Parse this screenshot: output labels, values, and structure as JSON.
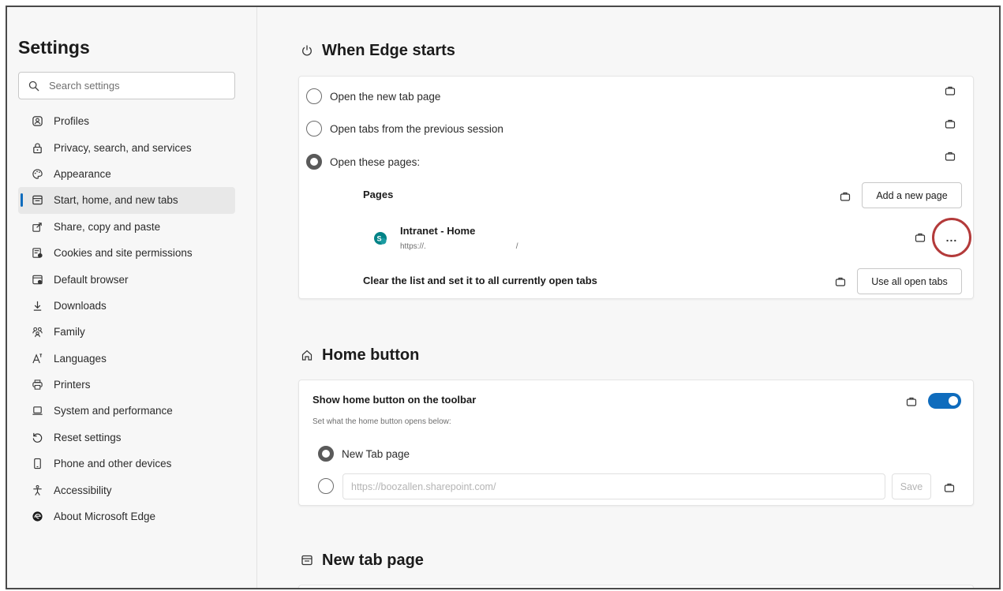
{
  "sidebar": {
    "title": "Settings",
    "search_placeholder": "Search settings",
    "items": [
      {
        "label": "Profiles",
        "icon": "profile-icon"
      },
      {
        "label": "Privacy, search, and services",
        "icon": "lock-icon"
      },
      {
        "label": "Appearance",
        "icon": "palette-icon"
      },
      {
        "label": "Start, home, and new tabs",
        "icon": "start-tabs-icon",
        "active": true
      },
      {
        "label": "Share, copy and paste",
        "icon": "share-icon"
      },
      {
        "label": "Cookies and site permissions",
        "icon": "cookies-icon"
      },
      {
        "label": "Default browser",
        "icon": "default-browser-icon"
      },
      {
        "label": "Downloads",
        "icon": "download-icon"
      },
      {
        "label": "Family",
        "icon": "family-icon"
      },
      {
        "label": "Languages",
        "icon": "languages-icon"
      },
      {
        "label": "Printers",
        "icon": "printer-icon"
      },
      {
        "label": "System and performance",
        "icon": "laptop-icon"
      },
      {
        "label": "Reset settings",
        "icon": "reset-icon"
      },
      {
        "label": "Phone and other devices",
        "icon": "phone-icon"
      },
      {
        "label": "Accessibility",
        "icon": "accessibility-icon"
      },
      {
        "label": "About Microsoft Edge",
        "icon": "edge-logo-icon"
      }
    ]
  },
  "startup": {
    "title": "When Edge starts",
    "option_new_tab": "Open the new tab page",
    "option_previous": "Open tabs from the previous session",
    "option_pages": "Open these pages:",
    "pages_label": "Pages",
    "add_page_button": "Add a new page",
    "page_title": "Intranet - Home",
    "page_url": "https://.                                         /",
    "page_more": "...",
    "clear_label": "Clear the list and set it to all currently open tabs",
    "use_open_tabs_button": "Use all open tabs"
  },
  "home": {
    "title": "Home button",
    "show_label": "Show home button on the toolbar",
    "sub_label": "Set what the home button opens below:",
    "option_new_tab": "New Tab page",
    "url_placeholder": "https://boozallen.sharepoint.com/",
    "save_button": "Save"
  },
  "newtab": {
    "title": "New tab page"
  },
  "colors": {
    "accent": "#0f6cbd",
    "highlight_circle": "#b33a3a",
    "sharepoint": "#038387"
  }
}
